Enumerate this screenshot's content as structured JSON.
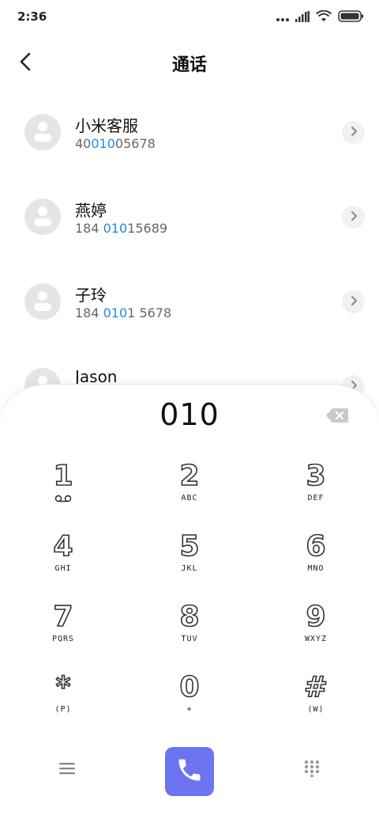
{
  "status_bar": {
    "time": "2:36",
    "icons": [
      "dots-icon",
      "signal-icon",
      "wifi-icon",
      "battery-icon"
    ]
  },
  "header": {
    "title": "通话",
    "back_icon": "back-arrow-icon"
  },
  "contacts": [
    {
      "name": "小米客服",
      "number_pre": "40",
      "number_hl": "010",
      "number_post": "05678"
    },
    {
      "name": "燕婷",
      "number_pre": "184 ",
      "number_hl": "010",
      "number_post": "15689"
    },
    {
      "name": "子玲",
      "number_pre": "184 ",
      "number_hl": "010",
      "number_post": "1 5678"
    },
    {
      "name": "Jason",
      "number_pre": "",
      "number_hl": "",
      "number_post": ""
    }
  ],
  "dialpad": {
    "display": "010",
    "keys": [
      {
        "digit": "1",
        "sub": ""
      },
      {
        "digit": "2",
        "sub": "ABC"
      },
      {
        "digit": "3",
        "sub": "DEF"
      },
      {
        "digit": "4",
        "sub": "GHI"
      },
      {
        "digit": "5",
        "sub": "JKL"
      },
      {
        "digit": "6",
        "sub": "MNO"
      },
      {
        "digit": "7",
        "sub": "PQRS"
      },
      {
        "digit": "8",
        "sub": "TUV"
      },
      {
        "digit": "9",
        "sub": "WXYZ"
      },
      {
        "digit": "*",
        "sub": "(P)"
      },
      {
        "digit": "0",
        "sub": "+"
      },
      {
        "digit": "#",
        "sub": "(W)"
      }
    ]
  },
  "colors": {
    "highlight": "#1a8ce6",
    "call_button": "#6c74f0",
    "avatar_bg": "#e3e5e9"
  }
}
